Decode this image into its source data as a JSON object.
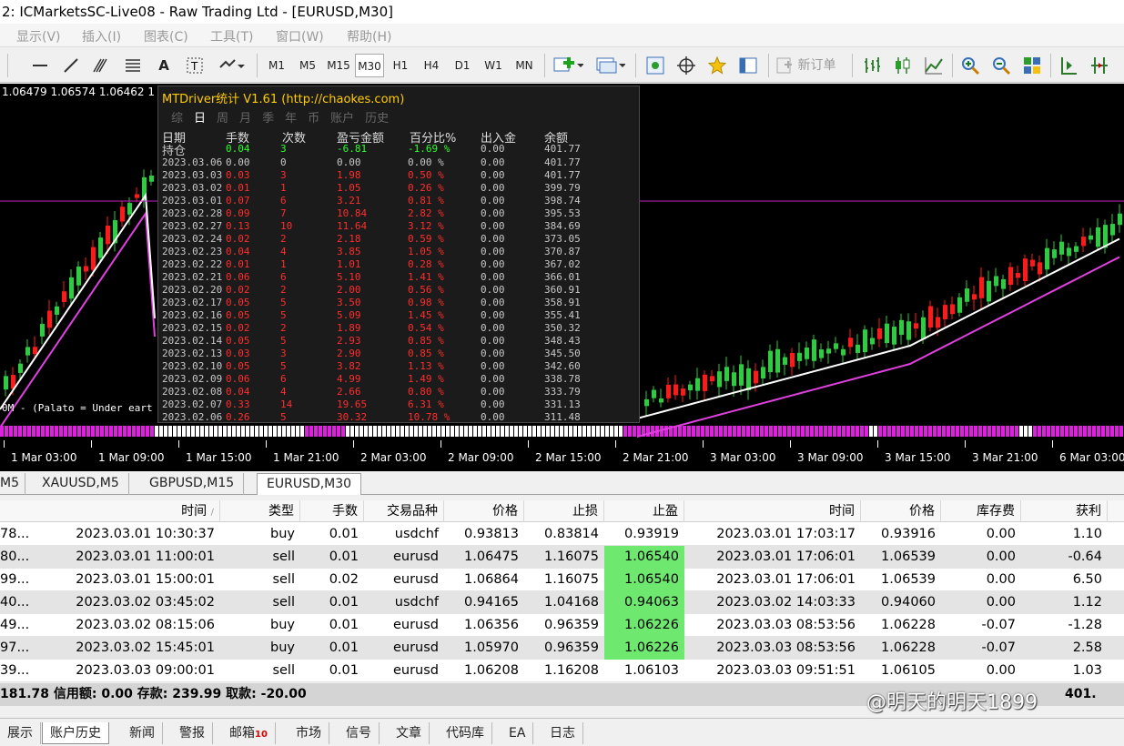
{
  "window": {
    "title": "2: ICMarketsSC-Live08 - Raw Trading Ltd - [EURUSD,M30]"
  },
  "menu": [
    "显示(V)",
    "插入(I)",
    "图表(C)",
    "工具(T)",
    "窗口(W)",
    "帮助(H)"
  ],
  "toolbar": {
    "timeframes": [
      "M1",
      "M5",
      "M15",
      "M30",
      "H1",
      "H4",
      "D1",
      "W1",
      "MN"
    ],
    "active_timeframe": "M30",
    "new_order_label": "新订单"
  },
  "chart": {
    "ohlc_text": "1.06479 1.06574 1.06462 1",
    "indicator_text": "0M - (Palato = Under eart",
    "x_ticks": [
      "1 Mar 03:00",
      "1 Mar 09:00",
      "1 Mar 15:00",
      "1 Mar 21:00",
      "2 Mar 03:00",
      "2 Mar 09:00",
      "2 Mar 15:00",
      "2 Mar 21:00",
      "3 Mar 03:00",
      "3 Mar 09:00",
      "3 Mar 15:00",
      "3 Mar 21:00",
      "6 Mar 03:00"
    ],
    "colors": {
      "background": "#000000",
      "bull": "#2ecc40",
      "bear": "#ff1a1a",
      "fast_ma": "#ffffff",
      "slow_ma": "#e040e0",
      "hline": "#c020c0"
    }
  },
  "stats_panel": {
    "title": "MTDriver统计 V1.61  (http://chaokes.com)",
    "tabs": [
      "综",
      "日",
      "周",
      "月",
      "季",
      "年",
      "币",
      "账户",
      "历史"
    ],
    "active_tab": "日",
    "headers": [
      "日期",
      "手数",
      "次数",
      "盈亏金额",
      "百分比%",
      "出入金",
      "余额"
    ],
    "position_row": {
      "date": "持仓",
      "lots": "0.04",
      "count": "3",
      "pnl": "-6.81",
      "pct": "-1.69 %",
      "inout": "0.00",
      "balance": "401.77"
    },
    "rows": [
      {
        "date": "2023.03.06",
        "lots": "0.00",
        "count": "0",
        "pnl": "0.00",
        "pct": "0.00 %",
        "inout": "0.00",
        "balance": "401.77"
      },
      {
        "date": "2023.03.03",
        "lots": "0.03",
        "count": "3",
        "pnl": "1.98",
        "pct": "0.50 %",
        "inout": "0.00",
        "balance": "401.77"
      },
      {
        "date": "2023.03.02",
        "lots": "0.01",
        "count": "1",
        "pnl": "1.05",
        "pct": "0.26 %",
        "inout": "0.00",
        "balance": "399.79"
      },
      {
        "date": "2023.03.01",
        "lots": "0.07",
        "count": "6",
        "pnl": "3.21",
        "pct": "0.81 %",
        "inout": "0.00",
        "balance": "398.74"
      },
      {
        "date": "2023.02.28",
        "lots": "0.09",
        "count": "7",
        "pnl": "10.84",
        "pct": "2.82 %",
        "inout": "0.00",
        "balance": "395.53"
      },
      {
        "date": "2023.02.27",
        "lots": "0.13",
        "count": "10",
        "pnl": "11.64",
        "pct": "3.12 %",
        "inout": "0.00",
        "balance": "384.69"
      },
      {
        "date": "2023.02.24",
        "lots": "0.02",
        "count": "2",
        "pnl": "2.18",
        "pct": "0.59 %",
        "inout": "0.00",
        "balance": "373.05"
      },
      {
        "date": "2023.02.23",
        "lots": "0.04",
        "count": "4",
        "pnl": "3.85",
        "pct": "1.05 %",
        "inout": "0.00",
        "balance": "370.87"
      },
      {
        "date": "2023.02.22",
        "lots": "0.01",
        "count": "1",
        "pnl": "1.01",
        "pct": "0.28 %",
        "inout": "0.00",
        "balance": "367.02"
      },
      {
        "date": "2023.02.21",
        "lots": "0.06",
        "count": "6",
        "pnl": "5.10",
        "pct": "1.41 %",
        "inout": "0.00",
        "balance": "366.01"
      },
      {
        "date": "2023.02.20",
        "lots": "0.02",
        "count": "2",
        "pnl": "2.00",
        "pct": "0.56 %",
        "inout": "0.00",
        "balance": "360.91"
      },
      {
        "date": "2023.02.17",
        "lots": "0.05",
        "count": "5",
        "pnl": "3.50",
        "pct": "0.98 %",
        "inout": "0.00",
        "balance": "358.91"
      },
      {
        "date": "2023.02.16",
        "lots": "0.05",
        "count": "5",
        "pnl": "5.09",
        "pct": "1.45 %",
        "inout": "0.00",
        "balance": "355.41"
      },
      {
        "date": "2023.02.15",
        "lots": "0.02",
        "count": "2",
        "pnl": "1.89",
        "pct": "0.54 %",
        "inout": "0.00",
        "balance": "350.32"
      },
      {
        "date": "2023.02.14",
        "lots": "0.05",
        "count": "5",
        "pnl": "2.93",
        "pct": "0.85 %",
        "inout": "0.00",
        "balance": "348.43"
      },
      {
        "date": "2023.02.13",
        "lots": "0.03",
        "count": "3",
        "pnl": "2.90",
        "pct": "0.85 %",
        "inout": "0.00",
        "balance": "345.50"
      },
      {
        "date": "2023.02.10",
        "lots": "0.05",
        "count": "5",
        "pnl": "3.82",
        "pct": "1.13 %",
        "inout": "0.00",
        "balance": "342.60"
      },
      {
        "date": "2023.02.09",
        "lots": "0.06",
        "count": "6",
        "pnl": "4.99",
        "pct": "1.49 %",
        "inout": "0.00",
        "balance": "338.78"
      },
      {
        "date": "2023.02.08",
        "lots": "0.04",
        "count": "4",
        "pnl": "2.66",
        "pct": "0.80 %",
        "inout": "0.00",
        "balance": "333.79"
      },
      {
        "date": "2023.02.07",
        "lots": "0.33",
        "count": "14",
        "pnl": "19.65",
        "pct": "6.31 %",
        "inout": "0.00",
        "balance": "331.13"
      },
      {
        "date": "2023.02.06",
        "lots": "0.26",
        "count": "5",
        "pnl": "30.32",
        "pct": "10.78 %",
        "inout": "0.00",
        "balance": "311.48"
      }
    ]
  },
  "chart_tabs": [
    "M5",
    "XAUUSD,M5",
    "GBPUSD,M15",
    "EURUSD,M30"
  ],
  "active_chart_tab": "EURUSD,M30",
  "history_table": {
    "headers": [
      "时间",
      "类型",
      "手数",
      "交易品种",
      "价格",
      "止损",
      "止盈",
      "时间",
      "价格",
      "库存费",
      "获利"
    ],
    "rows": [
      {
        "id": "78...",
        "open_time": "2023.03.01 10:30:37",
        "type": "buy",
        "lots": "0.01",
        "symbol": "usdchf",
        "price": "0.93813",
        "sl": "0.83814",
        "tp": "0.93919",
        "tp_hit": false,
        "close_time": "2023.03.01 17:03:17",
        "close_price": "0.93916",
        "swap": "0.00",
        "profit": "1.10"
      },
      {
        "id": "80...",
        "open_time": "2023.03.01 11:00:01",
        "type": "sell",
        "lots": "0.01",
        "symbol": "eurusd",
        "price": "1.06475",
        "sl": "1.16075",
        "tp": "1.06540",
        "tp_hit": true,
        "close_time": "2023.03.01 17:06:01",
        "close_price": "1.06539",
        "swap": "0.00",
        "profit": "-0.64"
      },
      {
        "id": "99...",
        "open_time": "2023.03.01 15:00:01",
        "type": "sell",
        "lots": "0.02",
        "symbol": "eurusd",
        "price": "1.06864",
        "sl": "1.16075",
        "tp": "1.06540",
        "tp_hit": true,
        "close_time": "2023.03.01 17:06:01",
        "close_price": "1.06539",
        "swap": "0.00",
        "profit": "6.50"
      },
      {
        "id": "40...",
        "open_time": "2023.03.02 03:45:02",
        "type": "sell",
        "lots": "0.01",
        "symbol": "usdchf",
        "price": "0.94165",
        "sl": "1.04168",
        "tp": "0.94063",
        "tp_hit": true,
        "close_time": "2023.03.02 14:03:33",
        "close_price": "0.94060",
        "swap": "0.00",
        "profit": "1.12"
      },
      {
        "id": "49...",
        "open_time": "2023.03.02 08:15:06",
        "type": "buy",
        "lots": "0.01",
        "symbol": "eurusd",
        "price": "1.06356",
        "sl": "0.96359",
        "tp": "1.06226",
        "tp_hit": true,
        "close_time": "2023.03.03 08:53:56",
        "close_price": "1.06228",
        "swap": "-0.07",
        "profit": "-1.28"
      },
      {
        "id": "97...",
        "open_time": "2023.03.02 15:45:01",
        "type": "buy",
        "lots": "0.01",
        "symbol": "eurusd",
        "price": "1.05970",
        "sl": "0.96359",
        "tp": "1.06226",
        "tp_hit": true,
        "close_time": "2023.03.03 08:53:56",
        "close_price": "1.06228",
        "swap": "-0.07",
        "profit": "2.58"
      },
      {
        "id": "39...",
        "open_time": "2023.03.03 09:00:01",
        "type": "sell",
        "lots": "0.01",
        "symbol": "eurusd",
        "price": "1.06208",
        "sl": "1.16208",
        "tp": "1.06103",
        "tp_hit": false,
        "close_time": "2023.03.03 09:51:51",
        "close_price": "1.06105",
        "swap": "0.00",
        "profit": "1.03"
      }
    ]
  },
  "summary": {
    "text": "181.78  信用额: 0.00  存款: 239.99  取款: -20.00",
    "partial_value": "401."
  },
  "watermark": "@明天的明天1899",
  "bottom_tabs": [
    {
      "label": "展示"
    },
    {
      "label": "账户历史",
      "active": true
    },
    {
      "label": "新闻"
    },
    {
      "label": "警报"
    },
    {
      "label": "邮箱",
      "badge": "10"
    },
    {
      "label": "市场"
    },
    {
      "label": "信号"
    },
    {
      "label": "文章"
    },
    {
      "label": "代码库"
    },
    {
      "label": "EA"
    },
    {
      "label": "日志"
    }
  ]
}
